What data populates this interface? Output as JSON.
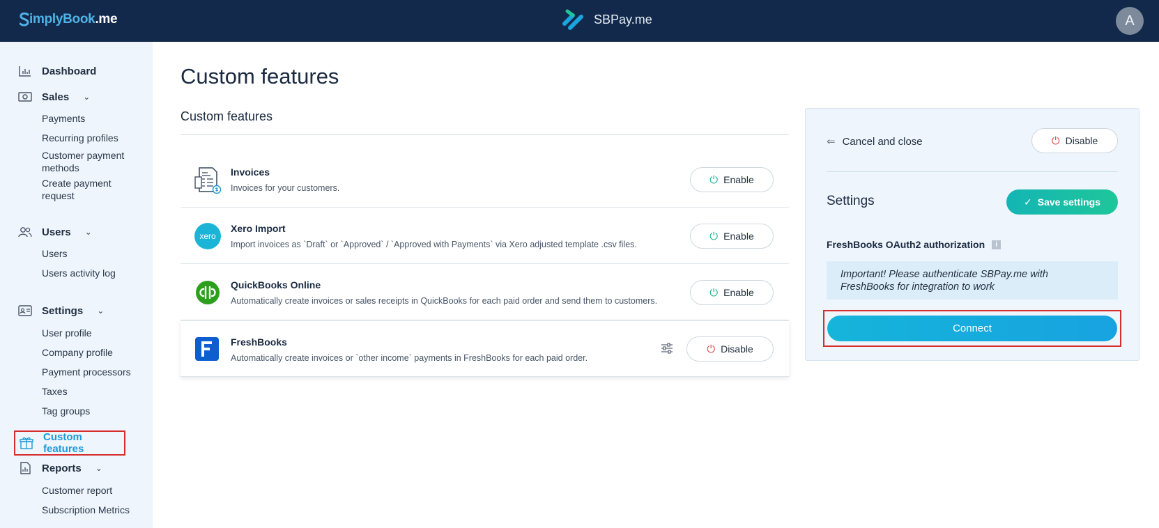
{
  "topbar": {
    "brand_main": "implyBook",
    "brand_suffix": ".me",
    "center_logo_text": "SBPay.me",
    "avatar_initial": "A"
  },
  "sidebar": {
    "dashboard": "Dashboard",
    "sales": {
      "label": "Sales",
      "items": [
        "Payments",
        "Recurring profiles",
        "Customer payment methods",
        "Create payment request"
      ]
    },
    "users": {
      "label": "Users",
      "items": [
        "Users",
        "Users activity log"
      ]
    },
    "settings": {
      "label": "Settings",
      "items": [
        "User profile",
        "Company profile",
        "Payment processors",
        "Taxes",
        "Tag groups"
      ]
    },
    "custom_features": "Custom features",
    "reports": {
      "label": "Reports",
      "items": [
        "Customer report",
        "Subscription Metrics"
      ]
    }
  },
  "main": {
    "page_title": "Custom features",
    "section_title": "Custom features",
    "features": [
      {
        "name": "Invoices",
        "desc": "Invoices for your customers.",
        "action": "Enable",
        "icon": "invoice-icon"
      },
      {
        "name": "Xero Import",
        "desc": "Import invoices as `Draft` or `Approved` / `Approved with Payments` via Xero adjusted template .csv files.",
        "action": "Enable",
        "icon": "xero-icon"
      },
      {
        "name": "QuickBooks Online",
        "desc": "Automatically create invoices or sales receipts in QuickBooks for each paid order and send them to customers.",
        "action": "Enable",
        "icon": "quickbooks-icon"
      },
      {
        "name": "FreshBooks",
        "desc": "Automatically create invoices or `other income` payments in FreshBooks for each paid order.",
        "action": "Disable",
        "icon": "freshbooks-icon"
      }
    ]
  },
  "panel": {
    "cancel_label": "Cancel and close",
    "disable_label": "Disable",
    "settings_title": "Settings",
    "save_label": "Save settings",
    "oauth_label": "FreshBooks OAuth2 authorization",
    "info_glyph": "i",
    "note_text": "Important! Please authenticate SBPay.me with FreshBooks for integration to work",
    "connect_label": "Connect"
  },
  "colors": {
    "topbar": "#13294b",
    "sidebar": "#eef5fc",
    "accent_blue": "#1e9ad6",
    "accent_green": "#1fc69a",
    "highlight_red": "#d62c2c"
  }
}
